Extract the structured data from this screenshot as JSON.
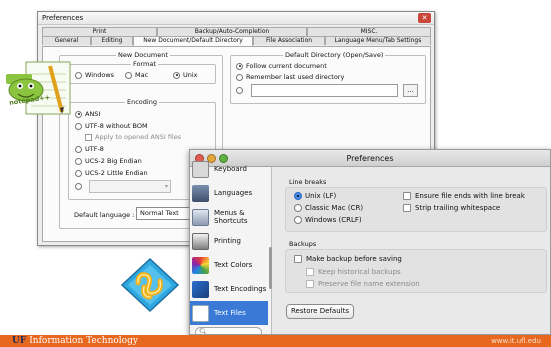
{
  "npp": {
    "title": "Preferences",
    "close_glyph": "✕",
    "tabs_top": [
      "Print",
      "Backup/Auto-Completion",
      "MISC."
    ],
    "tabs_bottom": [
      "General",
      "Editing",
      "New Document/Default Directory",
      "File Association",
      "Language Menu/Tab Settings"
    ],
    "new_document": {
      "group_title": "New Document",
      "format_title": "Format",
      "formats": [
        "Windows",
        "Mac",
        "Unix"
      ],
      "selected_format": "Unix",
      "encoding_title": "Encoding",
      "encodings": [
        "ANSI",
        "UTF-8 without BOM",
        "UTF-8",
        "UCS-2 Big Endian",
        "UCS-2 Little Endian"
      ],
      "selected_encoding": "ANSI",
      "apply_ansi_label": "Apply to opened ANSI files",
      "default_language_label": "Default language :",
      "default_language_value": "Normal Text"
    },
    "default_directory": {
      "group_title": "Default Directory (Open/Save)",
      "options": [
        "Follow current document",
        "Remember last used directory"
      ],
      "selected": "Follow current document",
      "browse_label": "..."
    }
  },
  "logos": {
    "npp_logo_text": "notepad++",
    "npp_logo_color": "#8bc53f"
  },
  "mac": {
    "title": "Preferences",
    "sidebar": [
      {
        "label": "Keyboard",
        "icon": "keyboard-icon"
      },
      {
        "label": "Languages",
        "icon": "languages-icon"
      },
      {
        "label": "Menus & Shortcuts",
        "icon": "menus-icon"
      },
      {
        "label": "Printing",
        "icon": "printer-icon"
      },
      {
        "label": "Text Colors",
        "icon": "text-colors-icon"
      },
      {
        "label": "Text Encodings",
        "icon": "text-encodings-icon"
      },
      {
        "label": "Text Files",
        "icon": "text-files-icon"
      }
    ],
    "selected_item": "Text Files",
    "search_glyph": "🔍︎",
    "line_breaks_label": "Line breaks",
    "line_breaks": [
      "Unix (LF)",
      "Classic Mac (CR)",
      "Windows (CRLF)"
    ],
    "selected_line_break": "Unix (LF)",
    "ensure_newline_label": "Ensure file ends with line break",
    "strip_whitespace_label": "Strip trailing whitespace",
    "backups_label": "Backups",
    "make_backup_label": "Make backup before saving",
    "keep_historical_label": "Keep historical backups",
    "preserve_ext_label": "Preserve file name extension",
    "restore_defaults_label": "Restore Defaults",
    "accent_color": "#3a7ad6"
  },
  "footer": {
    "left_mark": "UF",
    "left_text": "Information Technology",
    "right_text": "www.it.ufl.edu",
    "color": "#e8681f"
  }
}
